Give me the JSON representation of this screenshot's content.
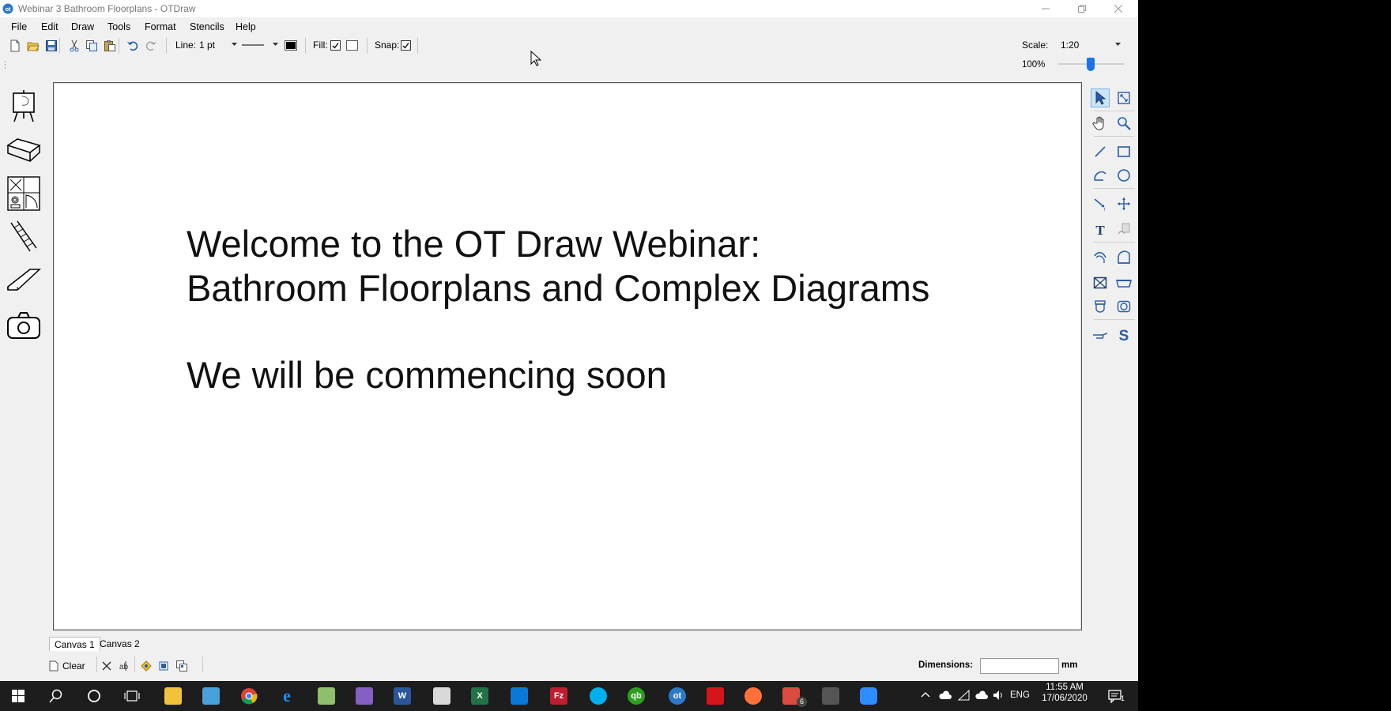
{
  "window": {
    "title": "Webinar 3 Bathroom Floorplans - OTDraw",
    "app_icon": "otdraw-logo"
  },
  "menu": [
    "File",
    "Edit",
    "Draw",
    "Tools",
    "Format",
    "Stencils",
    "Help"
  ],
  "toolbar": {
    "line_label": "Line:",
    "line_weight": "1 pt",
    "line_style": "solid",
    "line_color": "#000000",
    "fill_label": "Fill:",
    "fill_checked": true,
    "snap_label": "Snap:",
    "snap_checked": true,
    "scale_label": "Scale:",
    "scale_value": "1:20",
    "zoom_label": "100%",
    "zoom_level_fraction": 0.5,
    "icons": [
      "new-icon",
      "open-icon",
      "save-icon",
      "cut-icon",
      "copy-icon",
      "paste-icon",
      "undo-icon",
      "redo-icon"
    ]
  },
  "stencils": [
    "easel-icon",
    "bath-stencil-icon",
    "fixtures-stencil-icon",
    "ladder-stencil-icon",
    "ramp-stencil-icon",
    "camera-icon"
  ],
  "canvas": {
    "lines": [
      "Welcome to the OT Draw Webinar:",
      "Bathroom Floorplans and Complex Diagrams",
      "We will be commencing soon"
    ]
  },
  "tools": [
    "select-arrow-icon",
    "resize-icon",
    "pan-hand-icon",
    "zoom-icon",
    "line-icon",
    "rectangle-icon",
    "curve-icon",
    "circle-icon",
    "dimension-line-icon",
    "move-icon",
    "text-icon",
    "stencil-copy-icon",
    "handrail-icon",
    "wall-corner-icon",
    "window-icon",
    "bath-icon",
    "toilet-icon",
    "basin-icon",
    "grab-rail-icon",
    "s-curve-icon"
  ],
  "tabs": [
    "Canvas 1",
    "Canvas 2"
  ],
  "status": {
    "clear_label": "Clear",
    "dimensions_label": "Dimensions:",
    "dimensions_unit": "mm",
    "dimensions_value": ""
  },
  "taskbar": {
    "apps": [
      "start-icon",
      "search-icon",
      "cortana-icon",
      "task-view-icon",
      "file-explorer-icon",
      "tool-icon",
      "chrome-icon",
      "edge-icon",
      "notepad-icon",
      "visual-studio-icon",
      "word-icon",
      "snipping-icon",
      "excel-icon",
      "calendar-icon",
      "filezilla-icon",
      "skype-icon",
      "quickbooks-icon",
      "otdraw-icon",
      "acrobat-icon",
      "firefox-icon",
      "todoist-icon",
      "calculator-icon",
      "zoom-icon"
    ],
    "badge": "6",
    "lang": "ENG",
    "time": "11:55 AM",
    "date": "17/06/2020",
    "notification_count": "1"
  }
}
